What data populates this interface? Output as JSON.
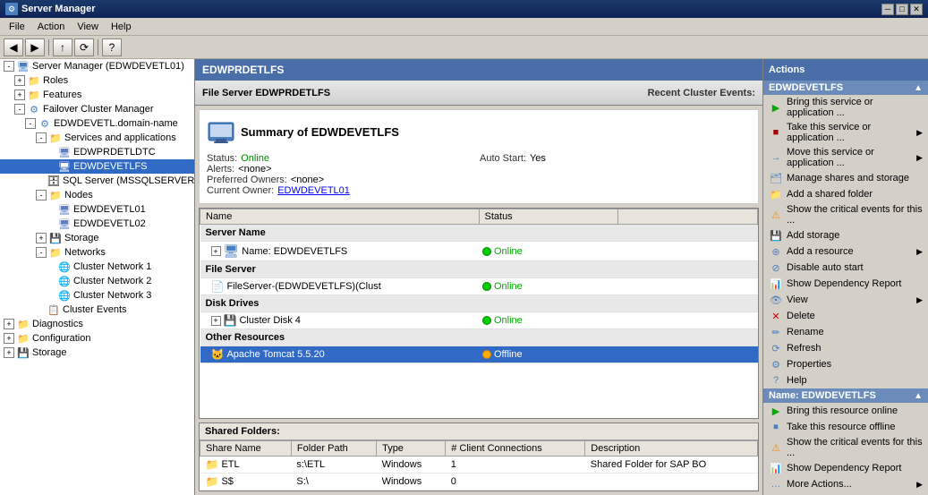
{
  "titlebar": {
    "title": "Server Manager",
    "min_btn": "─",
    "max_btn": "□",
    "close_btn": "✕"
  },
  "menubar": {
    "items": [
      "File",
      "Action",
      "View",
      "Help"
    ]
  },
  "left_panel": {
    "title": "Server Manager (EDWDEVETL01)",
    "tree": [
      {
        "id": "root",
        "label": "Server Manager (EDWDEVETL01)",
        "level": 0,
        "expanded": true,
        "icon": "computer"
      },
      {
        "id": "roles",
        "label": "Roles",
        "level": 1,
        "expanded": false,
        "icon": "folder"
      },
      {
        "id": "features",
        "label": "Features",
        "level": 1,
        "expanded": false,
        "icon": "folder"
      },
      {
        "id": "failover",
        "label": "Failover Cluster Manager",
        "level": 1,
        "expanded": true,
        "icon": "cluster"
      },
      {
        "id": "domain",
        "label": "EDWDEVETL.domain-name",
        "level": 2,
        "expanded": true,
        "icon": "cluster"
      },
      {
        "id": "services",
        "label": "Services and applications",
        "level": 3,
        "expanded": true,
        "icon": "folder"
      },
      {
        "id": "edwprdtc",
        "label": "EDWPRDETLDTC",
        "level": 4,
        "expanded": false,
        "icon": "app"
      },
      {
        "id": "edwdevetlfs",
        "label": "EDWDEVETLFS",
        "level": 4,
        "expanded": false,
        "icon": "app",
        "selected": true
      },
      {
        "id": "sqlserver",
        "label": "SQL Server (MSSQLSERVER)",
        "level": 4,
        "expanded": false,
        "icon": "app"
      },
      {
        "id": "nodes",
        "label": "Nodes",
        "level": 3,
        "expanded": true,
        "icon": "folder"
      },
      {
        "id": "node1",
        "label": "EDWDEVETL01",
        "level": 4,
        "expanded": false,
        "icon": "server"
      },
      {
        "id": "node2",
        "label": "EDWDEVETL02",
        "level": 4,
        "expanded": false,
        "icon": "server"
      },
      {
        "id": "storage",
        "label": "Storage",
        "level": 3,
        "expanded": false,
        "icon": "storage"
      },
      {
        "id": "networks",
        "label": "Networks",
        "level": 3,
        "expanded": true,
        "icon": "folder"
      },
      {
        "id": "net1",
        "label": "Cluster Network 1",
        "level": 4,
        "expanded": false,
        "icon": "network"
      },
      {
        "id": "net2",
        "label": "Cluster Network 2",
        "level": 4,
        "expanded": false,
        "icon": "network"
      },
      {
        "id": "net3",
        "label": "Cluster Network 3",
        "level": 4,
        "expanded": false,
        "icon": "network"
      },
      {
        "id": "clusterevents",
        "label": "Cluster Events",
        "level": 3,
        "expanded": false,
        "icon": "events"
      },
      {
        "id": "diagnostics",
        "label": "Diagnostics",
        "level": 0,
        "expanded": false,
        "icon": "folder"
      },
      {
        "id": "configuration",
        "label": "Configuration",
        "level": 0,
        "expanded": false,
        "icon": "folder"
      },
      {
        "id": "storage2",
        "label": "Storage",
        "level": 0,
        "expanded": false,
        "icon": "storage"
      }
    ]
  },
  "content": {
    "header": "EDWPRDETLFS",
    "fs_header_left": "File Server EDWPRDETLFS",
    "fs_header_right": "Recent Cluster Events:",
    "summary": {
      "title": "Summary of EDWDEVETLFS",
      "status_label": "Status:",
      "status_value": "Online",
      "autostart_label": "Auto Start:",
      "autostart_value": "Yes",
      "alerts_label": "Alerts:",
      "alerts_value": "<none>",
      "preferred_label": "Preferred Owners:",
      "preferred_value": "<none>",
      "owner_label": "Current Owner:",
      "owner_value": "EDWDEVETL01"
    },
    "resources": {
      "col_name": "Name",
      "col_status": "Status",
      "sections": [
        {
          "title": "Server Name",
          "rows": [
            {
              "name": "Name: EDWDEVETLFS",
              "status": "Online",
              "status_type": "online",
              "indent": true
            }
          ]
        },
        {
          "title": "File Server",
          "rows": [
            {
              "name": "FileServer-(EDWDEVETLFS)(Clust",
              "status": "Online",
              "status_type": "online",
              "indent": false
            }
          ]
        },
        {
          "title": "Disk Drives",
          "rows": [
            {
              "name": "Cluster Disk 4",
              "status": "Online",
              "status_type": "online",
              "indent": true
            }
          ]
        },
        {
          "title": "Other Resources",
          "rows": [
            {
              "name": "Apache Tomcat 5.5.20",
              "status": "Offline",
              "status_type": "offline",
              "indent": false,
              "selected": true
            }
          ]
        }
      ]
    },
    "shared_folders": {
      "title": "Shared Folders:",
      "columns": [
        "Share Name",
        "Folder Path",
        "Type",
        "# Client Connections",
        "Description"
      ],
      "rows": [
        {
          "share": "ETL",
          "path": "s:\\ETL",
          "type": "Windows",
          "connections": "1",
          "description": "Shared Folder for SAP BO"
        },
        {
          "share": "S$",
          "path": "S:\\",
          "type": "Windows",
          "connections": "0",
          "description": ""
        }
      ]
    }
  },
  "actions": {
    "header": "Actions",
    "section1_title": "EDWDEVETLFS",
    "items1": [
      {
        "label": "Bring this service or application ...",
        "icon": "start",
        "has_sub": false
      },
      {
        "label": "Take this service or application ...",
        "icon": "stop",
        "has_sub": true
      },
      {
        "label": "Move this service or application ...",
        "icon": "move",
        "has_sub": true
      },
      {
        "label": "Manage shares and storage",
        "icon": "manage",
        "has_sub": false
      },
      {
        "label": "Add a shared folder",
        "icon": "folder-add",
        "has_sub": false
      },
      {
        "label": "Show the critical events for this ...",
        "icon": "events",
        "has_sub": false
      },
      {
        "label": "Add storage",
        "icon": "storage",
        "has_sub": false
      },
      {
        "label": "Add a resource",
        "icon": "resource",
        "has_sub": true
      },
      {
        "label": "Disable auto start",
        "icon": "disable",
        "has_sub": false
      },
      {
        "label": "Show Dependency Report",
        "icon": "report",
        "has_sub": false
      },
      {
        "label": "View",
        "icon": "view",
        "has_sub": true
      },
      {
        "label": "Delete",
        "icon": "delete",
        "has_sub": false
      },
      {
        "label": "Rename",
        "icon": "rename",
        "has_sub": false
      },
      {
        "label": "Refresh",
        "icon": "refresh",
        "has_sub": false
      },
      {
        "label": "Properties",
        "icon": "props",
        "has_sub": false
      },
      {
        "label": "Help",
        "icon": "help",
        "has_sub": false
      }
    ],
    "section2_title": "Name: EDWDEVETLFS",
    "items2": [
      {
        "label": "Bring this resource online",
        "icon": "start",
        "has_sub": false
      },
      {
        "label": "Take this resource offline",
        "icon": "stop",
        "has_sub": false
      },
      {
        "label": "Show the critical events for this ...",
        "icon": "events",
        "has_sub": false
      },
      {
        "label": "Show Dependency Report",
        "icon": "report",
        "has_sub": false
      },
      {
        "label": "More Actions...",
        "icon": "more",
        "has_sub": true
      }
    ]
  }
}
